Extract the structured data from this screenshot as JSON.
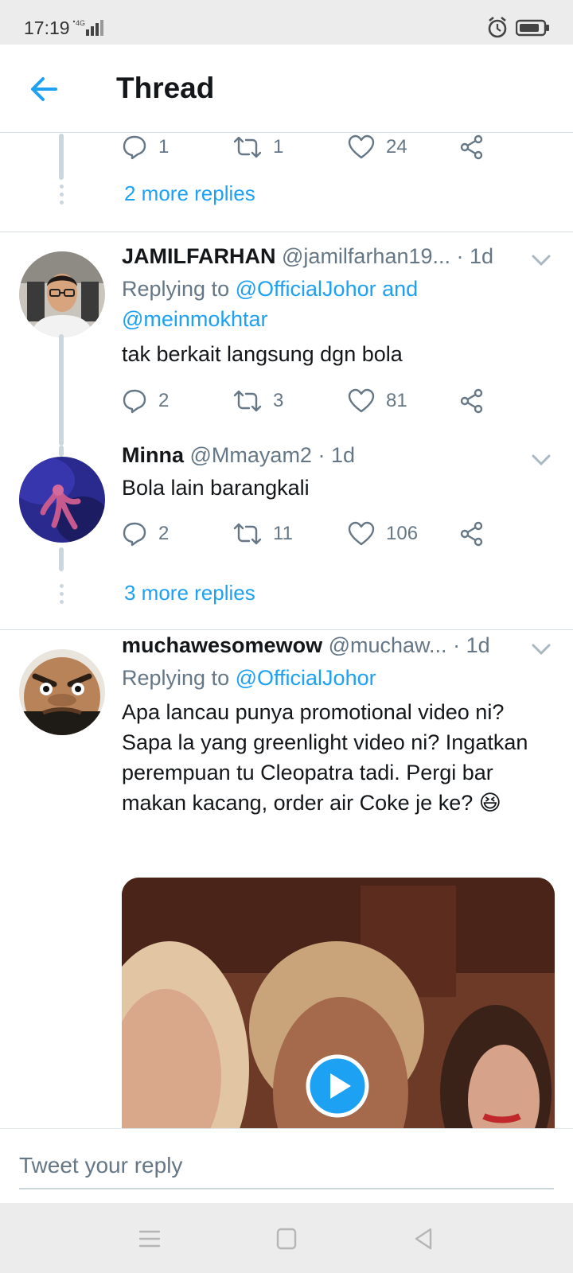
{
  "status_bar": {
    "time": "17:19",
    "network": "4G"
  },
  "header": {
    "title": "Thread"
  },
  "partial_tweet": {
    "actions": {
      "replies": "1",
      "retweets": "1",
      "likes": "24"
    },
    "more_replies": "2 more replies"
  },
  "tweets": [
    {
      "name": "JAMILFARHAN",
      "handle": "@jamilfarhan19...",
      "time": "· 1d",
      "replying_label": "Replying to",
      "replying_mentions": "@OfficialJohor and @meinmokhtar",
      "text": "tak berkait langsung dgn bola",
      "actions": {
        "replies": "2",
        "retweets": "3",
        "likes": "81"
      }
    },
    {
      "name": "Minna",
      "handle": "@Mmayam2",
      "time": "· 1d",
      "text": "Bola lain barangkali",
      "actions": {
        "replies": "2",
        "retweets": "11",
        "likes": "106"
      },
      "more_replies": "3 more replies"
    },
    {
      "name": "muchawesomewow",
      "handle": "@muchaw...",
      "time": "· 1d",
      "replying_label": "Replying to",
      "replying_mentions": "@OfficialJohor",
      "text": "Apa lancau punya promotional video ni? Sapa la yang greenlight video ni? Ingatkan perempuan tu Cleopatra tadi. Pergi bar makan kacang, order air Coke je ke? 😆"
    }
  ],
  "reply_bar": {
    "placeholder": "Tweet your reply"
  },
  "colors": {
    "accent": "#1da1f2",
    "secondary_text": "#657786",
    "thread_line": "#ccd6dd"
  }
}
